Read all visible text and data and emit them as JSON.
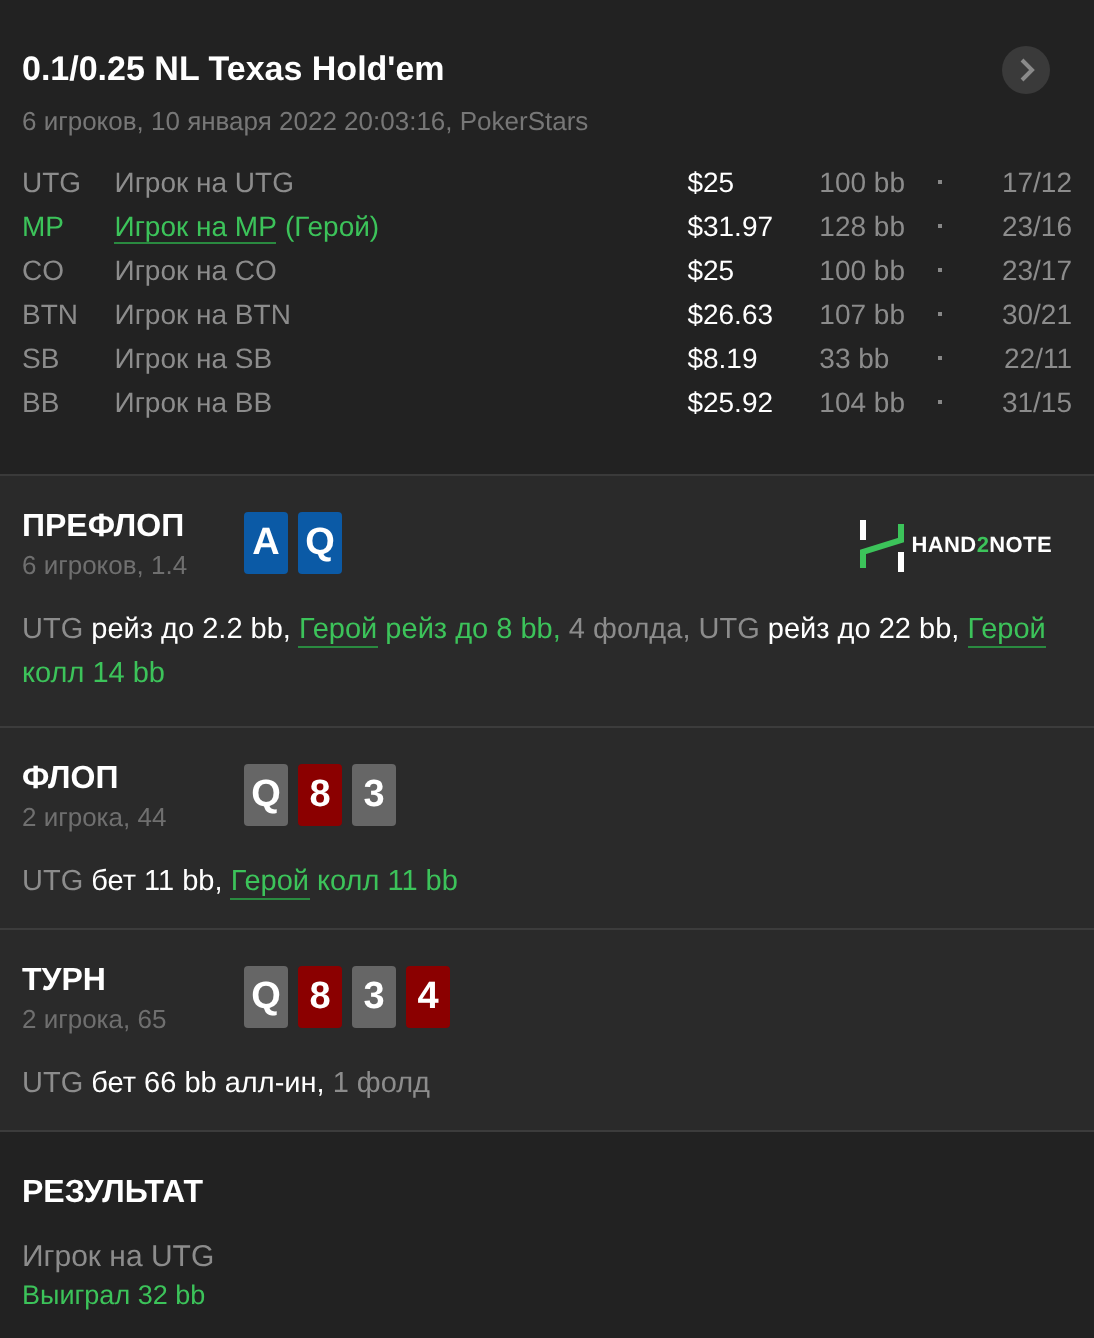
{
  "header": {
    "title": "0.1/0.25 NL Texas Hold'em",
    "subtitle": "6 игроков, 10 января 2022 20:03:16, PokerStars"
  },
  "players": [
    {
      "position": "UTG",
      "name": "Игрок на UTG",
      "hero": false,
      "stack": "$25",
      "bb": "100 bb",
      "stats": "17/12"
    },
    {
      "position": "MP",
      "name": "Игрок на MP",
      "hero": true,
      "tag": "(Герой)",
      "stack": "$31.97",
      "bb": "128 bb",
      "stats": "23/16"
    },
    {
      "position": "CO",
      "name": "Игрок на CO",
      "hero": false,
      "stack": "$25",
      "bb": "100 bb",
      "stats": "23/17"
    },
    {
      "position": "BTN",
      "name": "Игрок на BTN",
      "hero": false,
      "stack": "$26.63",
      "bb": "107 bb",
      "stats": "30/21"
    },
    {
      "position": "SB",
      "name": "Игрок на SB",
      "hero": false,
      "stack": "$8.19",
      "bb": "33 bb",
      "stats": "22/11"
    },
    {
      "position": "BB",
      "name": "Игрок на BB",
      "hero": false,
      "stack": "$25.92",
      "bb": "104 bb",
      "stats": "31/15"
    }
  ],
  "streets": [
    {
      "title": "ПРЕФЛОП",
      "subtitle": "6 игроков, 1.4",
      "logo": [
        {
          "text": "HAND",
          "accent": false
        },
        {
          "text": "2",
          "accent": true
        },
        {
          "text": "NOTE",
          "accent": false
        }
      ],
      "cards": [
        {
          "rank": "A",
          "color": "#0b5aa6"
        },
        {
          "rank": "Q",
          "color": "#0b5aa6"
        }
      ],
      "actions": [
        {
          "kind": "player",
          "text": "UTG"
        },
        {
          "kind": "action",
          "text": " рейз до 2.2 bb, "
        },
        {
          "kind": "hero",
          "text": "Герой"
        },
        {
          "kind": "hero_action",
          "text": " рейз до 8 bb,"
        },
        {
          "kind": "muted",
          "text": " 4 фолда, UTG"
        },
        {
          "kind": "action",
          "text": " рейз до 22 bb, "
        },
        {
          "kind": "hero",
          "text": "Герой"
        },
        {
          "kind": "hero_action",
          "text": " колл 14 bb"
        }
      ]
    },
    {
      "title": "ФЛОП",
      "subtitle": "2 игрока, 44",
      "cards": [
        {
          "rank": "Q",
          "color": "#666666"
        },
        {
          "rank": "8",
          "color": "#8b0000"
        },
        {
          "rank": "3",
          "color": "#666666"
        }
      ],
      "actions": [
        {
          "kind": "player",
          "text": "UTG"
        },
        {
          "kind": "action",
          "text": " бет 11 bb, "
        },
        {
          "kind": "hero",
          "text": "Герой"
        },
        {
          "kind": "hero_action",
          "text": " колл 11 bb"
        }
      ]
    },
    {
      "title": "ТУРН",
      "subtitle": "2 игрока, 65",
      "cards": [
        {
          "rank": "Q",
          "color": "#666666"
        },
        {
          "rank": "8",
          "color": "#8b0000"
        },
        {
          "rank": "3",
          "color": "#666666"
        },
        {
          "rank": "4",
          "color": "#8b0000"
        }
      ],
      "actions": [
        {
          "kind": "player",
          "text": "UTG"
        },
        {
          "kind": "action",
          "text": " бет 66 bb алл-ин,"
        },
        {
          "kind": "muted",
          "text": " 1 фолд"
        }
      ]
    }
  ],
  "result": {
    "title": "РЕЗУЛЬТАТ",
    "player": "Игрок на UTG",
    "outcome": "Выиграл 32 bb"
  }
}
